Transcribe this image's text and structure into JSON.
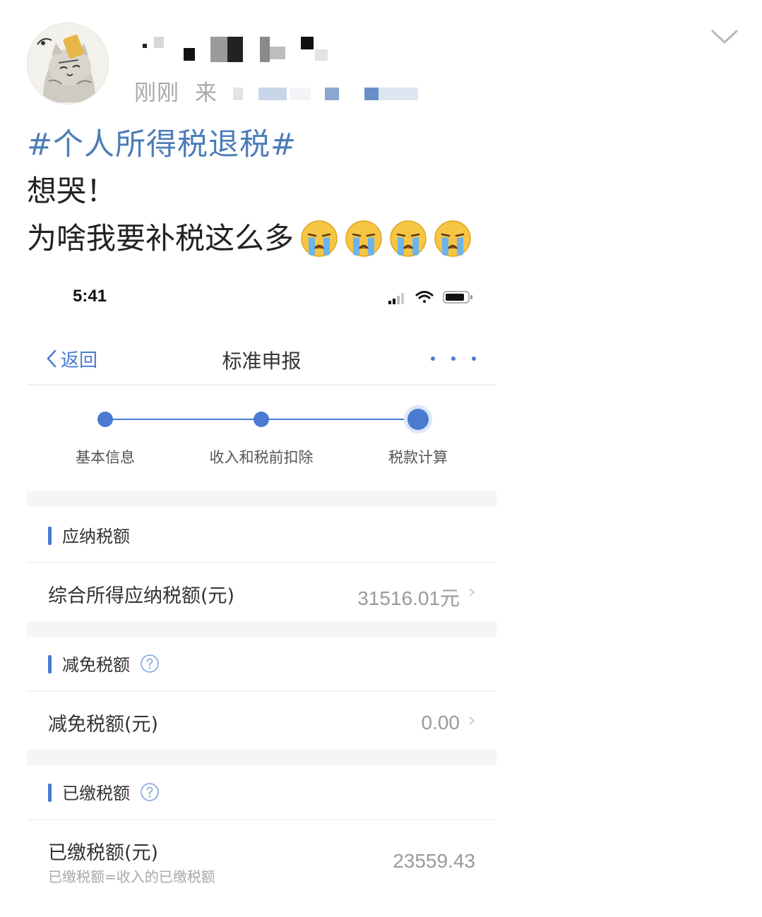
{
  "post": {
    "time_label": "刚刚",
    "source_label": "来",
    "hashtag": "#个人所得税退税#",
    "text_line1": "想哭！",
    "text_line2": "为啥我要补税这么多",
    "emoji": [
      "crying-face-emoji",
      "crying-face-emoji",
      "crying-face-emoji",
      "crying-face-emoji"
    ]
  },
  "screenshot": {
    "status_bar": {
      "time": "5:41"
    },
    "nav": {
      "back_label": "返回",
      "title": "标准申报"
    },
    "steps": [
      {
        "label": "基本信息"
      },
      {
        "label": "收入和税前扣除"
      },
      {
        "label": "税款计算"
      }
    ],
    "sections": {
      "payable": {
        "title": "应纳税额",
        "row_label": "综合所得应纳税额(元)",
        "row_value": "31516.01元"
      },
      "reduction": {
        "title": "减免税额",
        "row_label": "减免税额(元)",
        "row_value": "0.00"
      },
      "paid": {
        "title": "已缴税额",
        "row_label": "已缴税额(元)",
        "row_sub": "已缴税额=收入的已缴税额",
        "row_value": "23559.43"
      }
    }
  },
  "colors": {
    "hashtag": "#4d7db8",
    "accent_blue": "#4a7bd0",
    "muted_text": "#9a9a9a",
    "divider_gray": "#f4f5f7"
  }
}
